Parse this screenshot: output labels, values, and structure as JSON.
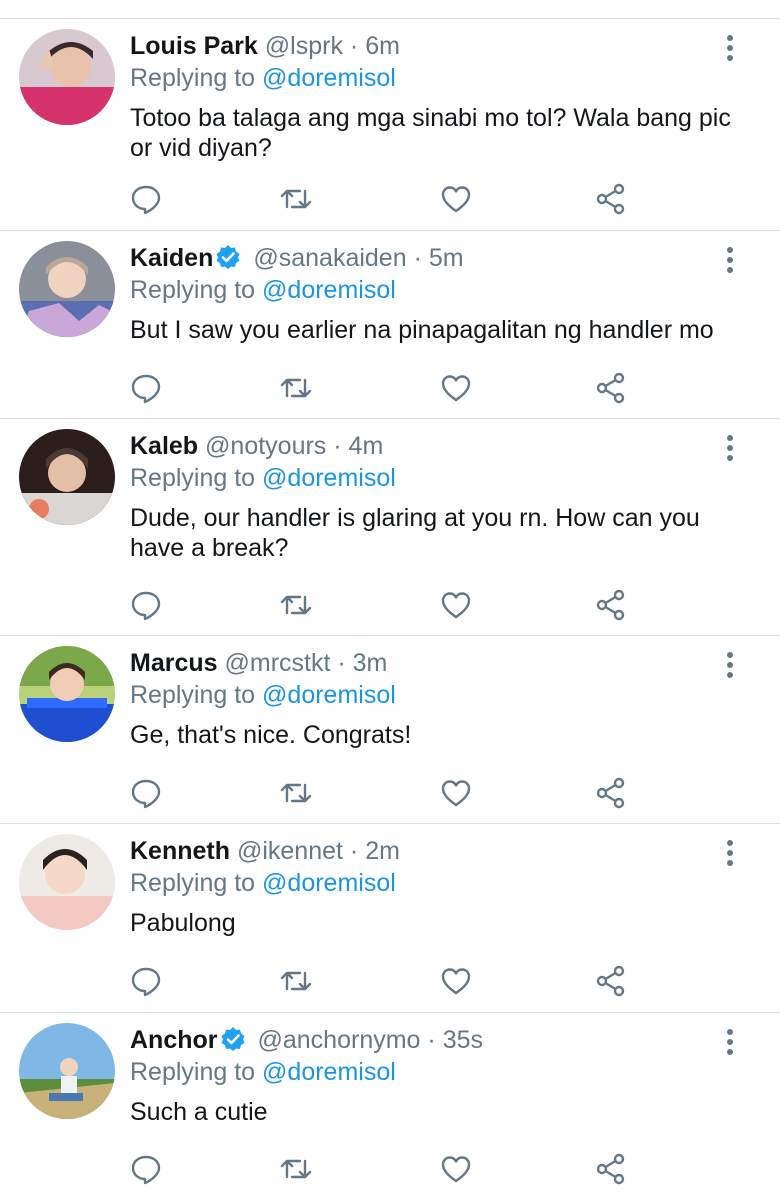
{
  "reply_prefix": "Replying to",
  "colors": {
    "link": "#1b95e0",
    "muted": "#657786",
    "text": "#14171a",
    "divider": "#d9dee3",
    "verified": "#1da1f2"
  },
  "icons": {
    "menu": "more-vertical-icon",
    "reply": "reply-icon",
    "retweet": "retweet-icon",
    "like": "heart-icon",
    "share": "share-icon",
    "verified": "verified-badge-icon"
  },
  "tweets": [
    {
      "name": "Louis Park",
      "verified": false,
      "handle": "@lsprk",
      "sep": "·",
      "time": "6m",
      "replying_to": "@doremisol",
      "text": "Totoo ba talaga ang mga sinabi mo tol? Wala bang pic or vid diyan?"
    },
    {
      "name": "Kaiden",
      "verified": true,
      "handle": "@sanakaiden",
      "sep": "·",
      "time": "5m",
      "replying_to": "@doremisol",
      "text": "But I saw you earlier na pinapagalitan ng handler mo"
    },
    {
      "name": "Kaleb",
      "verified": false,
      "handle": "@notyours",
      "sep": "·",
      "time": "4m",
      "replying_to": "@doremisol",
      "text": "Dude, our handler is glaring at you rn. How can you have a break?"
    },
    {
      "name": "Marcus",
      "verified": false,
      "handle": "@mrcstkt",
      "sep": "·",
      "time": "3m",
      "replying_to": "@doremisol",
      "text": "Ge, that's nice. Congrats!"
    },
    {
      "name": "Kenneth",
      "verified": false,
      "handle": "@ikennet",
      "sep": "·",
      "time": "2m",
      "replying_to": "@doremisol",
      "text": "Pabulong"
    },
    {
      "name": "Anchor",
      "verified": true,
      "handle": "@anchornymo",
      "sep": "·",
      "time": "35s",
      "replying_to": "@doremisol",
      "text": "Such a cutie"
    }
  ]
}
